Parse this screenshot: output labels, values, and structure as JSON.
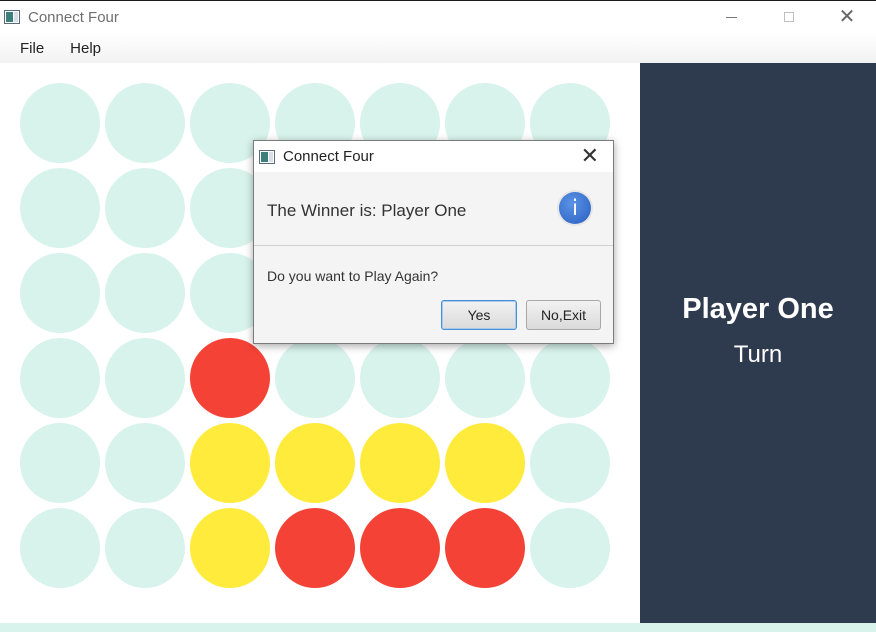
{
  "window": {
    "title": "Connect Four",
    "app_icon": "connect-four-app-icon",
    "controls": [
      "minimize-icon",
      "maximize-icon",
      "close-icon"
    ],
    "close_glyph": "✕"
  },
  "menu": {
    "items": [
      "File",
      "Help"
    ]
  },
  "board": {
    "columns": 7,
    "rows": 6,
    "colors": {
      "empty": "#d8f3ec",
      "red": "#f44336",
      "yellow": "#ffeb3b"
    },
    "grid": [
      [
        "empty",
        "empty",
        "empty",
        "empty",
        "empty",
        "empty",
        "empty"
      ],
      [
        "empty",
        "empty",
        "empty",
        "empty",
        "empty",
        "empty",
        "empty"
      ],
      [
        "empty",
        "empty",
        "empty",
        "empty",
        "empty",
        "empty",
        "empty"
      ],
      [
        "empty",
        "empty",
        "red",
        "empty",
        "empty",
        "empty",
        "empty"
      ],
      [
        "empty",
        "empty",
        "yellow",
        "yellow",
        "yellow",
        "yellow",
        "empty"
      ],
      [
        "empty",
        "empty",
        "yellow",
        "red",
        "red",
        "red",
        "empty"
      ]
    ]
  },
  "side_panel": {
    "player_name": "Player One",
    "turn_label": "Turn",
    "background": "#2e3b4e"
  },
  "dialog": {
    "title": "Connect Four",
    "close_glyph": "✕",
    "header_text": "The Winner is: Player One",
    "info_icon": "information-icon",
    "info_glyph": "i",
    "content_text": "Do you want to Play Again?",
    "buttons": {
      "yes": "Yes",
      "no": "No,Exit"
    }
  }
}
